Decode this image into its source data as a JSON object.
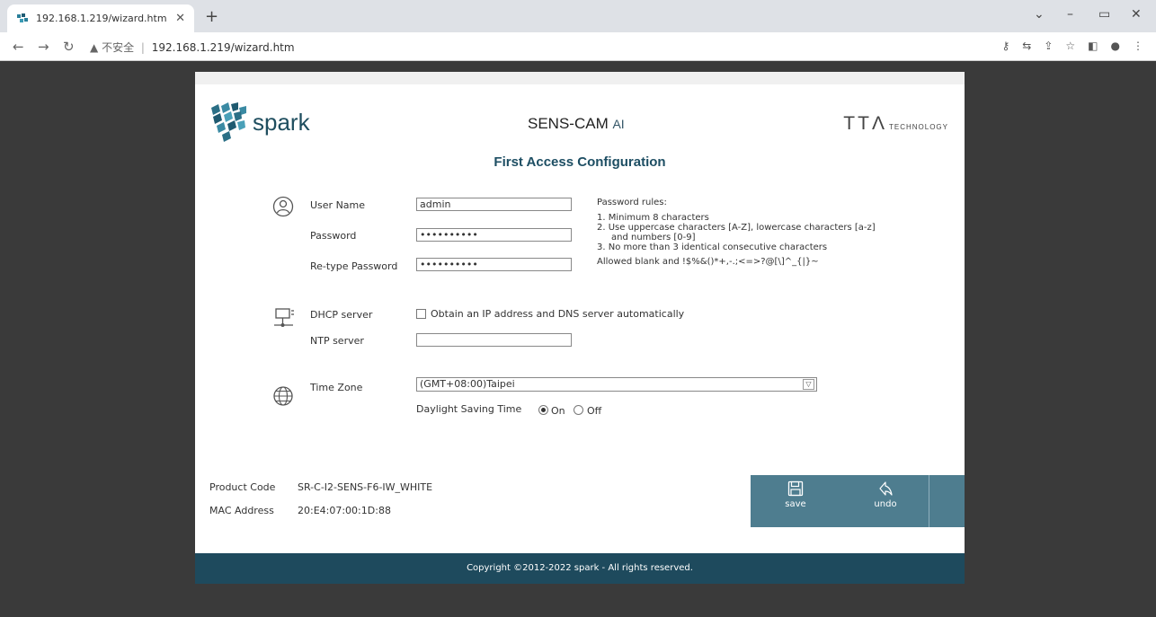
{
  "browser": {
    "tab_title": "192.168.1.219/wizard.htm",
    "tab_close": "✕",
    "new_tab": "+",
    "url_security": "不安全",
    "url_separator": "|",
    "url": "192.168.1.219/wizard.htm",
    "window_controls": [
      "⌄",
      "–",
      "▭",
      "✕"
    ]
  },
  "header": {
    "logo_text": "spark",
    "product_name": "SENS-CAM",
    "product_suffix": "AI",
    "partner_mark": "TTΛ",
    "partner_tech": "TECHNOLOGY"
  },
  "form": {
    "title": "First Access Configuration",
    "user_name_label": "User Name",
    "user_name_value": "admin",
    "password_label": "Password",
    "password_value": "••••••••••",
    "retype_label": "Re-type Password",
    "retype_value": "••••••••••",
    "rules_title": "Password rules:",
    "rules": [
      "1. Minimum 8 characters",
      "2. Use uppercase characters [A-Z], lowercase characters [a-z]",
      "    and numbers [0-9]",
      "3. No more than 3 identical consecutive characters"
    ],
    "allowed": "Allowed blank and !$%&()*+,-.;<=>?@[\\]^_{|}~",
    "dhcp_label": "DHCP server",
    "dhcp_option": "Obtain an IP address and DNS server automatically",
    "ntp_label": "NTP server",
    "ntp_value": "",
    "timezone_label": "Time Zone",
    "timezone_value": "(GMT+08:00)Taipei",
    "dst_label": "Daylight Saving Time",
    "dst_on": "On",
    "dst_off": "Off"
  },
  "device": {
    "product_code_label": "Product Code",
    "product_code": "SR-C-I2-SENS-F6-IW_WHITE",
    "mac_label": "MAC Address",
    "mac": "20:E4:07:00:1D:88"
  },
  "actions": {
    "save": "save",
    "undo": "undo"
  },
  "footer": {
    "copyright": "Copyright ©2012-2022 spark - All rights reserved."
  }
}
